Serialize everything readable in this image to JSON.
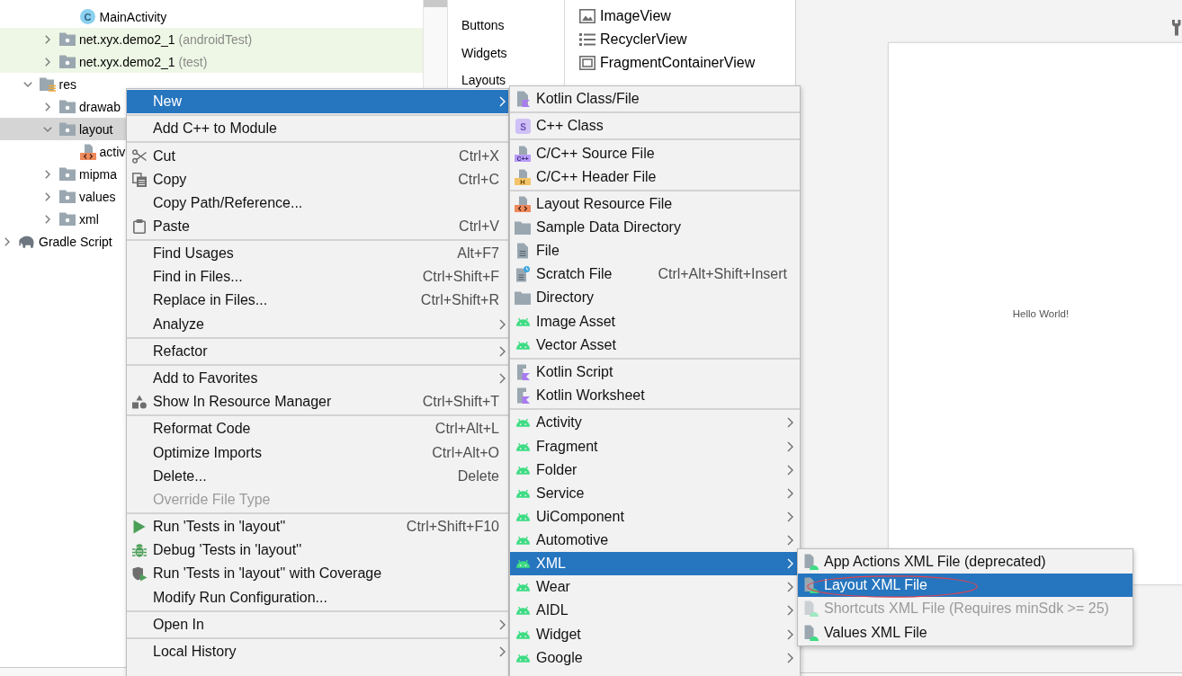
{
  "project_tree": {
    "items": [
      {
        "children": [
          {
            "children": [
              {
                "children": [
                  {
                    "label": "MainActivity",
                    "kind": "class",
                    "icon_text": "C",
                    "selected": false,
                    "test_source": false
                  }
                ]
              },
              {
                "label": "net.xyx.demo2_1",
                "note": "(androidTest)",
                "kind": "folder",
                "expanded": false,
                "selected": false,
                "test_source": true
              },
              {
                "label": "net.xyx.demo2_1",
                "note": "(test)",
                "kind": "folder",
                "expanded": false,
                "selected": false,
                "test_source": true
              }
            ]
          },
          {
            "label": "res",
            "kind": "resfolder",
            "expanded": true,
            "selected": false,
            "test_source": false,
            "children": [
              {
                "label": "drawab",
                "kind": "folder",
                "expanded": false,
                "selected": false,
                "test_source": false
              },
              {
                "label": "layout",
                "kind": "folder",
                "expanded": true,
                "selected": true,
                "test_source": false,
                "children": [
                  {
                    "label": "activ",
                    "kind": "layout",
                    "selected": false,
                    "test_source": false
                  }
                ]
              },
              {
                "label": "mipma",
                "kind": "folder",
                "expanded": false,
                "selected": false,
                "test_source": false
              },
              {
                "label": "values",
                "kind": "folder",
                "expanded": false,
                "selected": false,
                "test_source": false
              },
              {
                "label": "xml",
                "kind": "folder",
                "expanded": false,
                "selected": false,
                "test_source": false
              }
            ]
          }
        ]
      },
      {
        "label": "Gradle Script",
        "kind": "gradle",
        "expanded": false,
        "selected": false,
        "test_source": false
      }
    ]
  },
  "palette": {
    "categories": [
      {
        "label": "Buttons",
        "selected": false
      },
      {
        "label": "Widgets",
        "selected": false
      },
      {
        "label": "Layouts",
        "selected": false
      }
    ],
    "widgets": [
      {
        "label": "ImageView",
        "kind": "image"
      },
      {
        "label": "RecyclerView",
        "kind": "list"
      },
      {
        "label": "FragmentContainerView",
        "kind": "frame"
      }
    ]
  },
  "design": {
    "canvas_text": "Hello World!"
  },
  "context_menu": {
    "groups": [
      {
        "items": [
          {
            "label": "New",
            "kind": "plain",
            "selected": true,
            "disabled": false,
            "has_submenu": true,
            "submenu": {
              "groups": [
                {
                  "items": [
                    {
                      "label": "Kotlin Class/File",
                      "kind": "kotlin",
                      "selected": false,
                      "disabled": false,
                      "has_submenu": false
                    }
                  ]
                },
                {
                  "items": [
                    {
                      "label": "C++ Class",
                      "kind": "cppclass",
                      "icon_text": "S",
                      "selected": false,
                      "disabled": false,
                      "has_submenu": false
                    }
                  ]
                },
                {
                  "items": [
                    {
                      "label": "C/C++ Source File",
                      "kind": "cppsource",
                      "icon_text": "C++",
                      "selected": false,
                      "disabled": false,
                      "has_submenu": false
                    },
                    {
                      "label": "C/C++ Header File",
                      "kind": "cppheader",
                      "icon_text": "H",
                      "selected": false,
                      "disabled": false,
                      "has_submenu": false
                    }
                  ]
                },
                {
                  "items": [
                    {
                      "label": "Layout Resource File",
                      "kind": "layout",
                      "selected": false,
                      "disabled": false,
                      "has_submenu": false
                    },
                    {
                      "label": "Sample Data Directory",
                      "kind": "folder",
                      "selected": false,
                      "disabled": false,
                      "has_submenu": false
                    },
                    {
                      "label": "File",
                      "kind": "file",
                      "selected": false,
                      "disabled": false,
                      "has_submenu": false
                    },
                    {
                      "label": "Scratch File",
                      "shortcut": "Ctrl+Alt+Shift+Insert",
                      "kind": "scratch",
                      "selected": false,
                      "disabled": false,
                      "has_submenu": false
                    },
                    {
                      "label": "Directory",
                      "kind": "folder",
                      "selected": false,
                      "disabled": false,
                      "has_submenu": false
                    },
                    {
                      "label": "Image Asset",
                      "kind": "android",
                      "selected": false,
                      "disabled": false,
                      "has_submenu": false
                    },
                    {
                      "label": "Vector Asset",
                      "kind": "android",
                      "selected": false,
                      "disabled": false,
                      "has_submenu": false
                    }
                  ]
                },
                {
                  "items": [
                    {
                      "label": "Kotlin Script",
                      "kind": "kotlinscript",
                      "selected": false,
                      "disabled": false,
                      "has_submenu": false
                    },
                    {
                      "label": "Kotlin Worksheet",
                      "kind": "kotlinscript",
                      "selected": false,
                      "disabled": false,
                      "has_submenu": false
                    }
                  ]
                },
                {
                  "items": [
                    {
                      "label": "Activity",
                      "kind": "android",
                      "selected": false,
                      "disabled": false,
                      "has_submenu": true
                    },
                    {
                      "label": "Fragment",
                      "kind": "android",
                      "selected": false,
                      "disabled": false,
                      "has_submenu": true
                    },
                    {
                      "label": "Folder",
                      "kind": "android",
                      "selected": false,
                      "disabled": false,
                      "has_submenu": true
                    },
                    {
                      "label": "Service",
                      "kind": "android",
                      "selected": false,
                      "disabled": false,
                      "has_submenu": true
                    },
                    {
                      "label": "UiComponent",
                      "kind": "android",
                      "selected": false,
                      "disabled": false,
                      "has_submenu": true
                    },
                    {
                      "label": "Automotive",
                      "kind": "android",
                      "selected": false,
                      "disabled": false,
                      "has_submenu": true
                    },
                    {
                      "label": "XML",
                      "kind": "android",
                      "selected": true,
                      "disabled": false,
                      "has_submenu": true,
                      "submenu": {
                        "groups": [
                          {
                            "items": [
                              {
                                "label": "App Actions XML File (deprecated)",
                                "kind": "xmlfile",
                                "selected": false,
                                "disabled": false,
                                "has_submenu": false,
                                "circled": false
                              },
                              {
                                "label": "Layout XML File",
                                "kind": "xmlfile",
                                "selected": true,
                                "disabled": false,
                                "has_submenu": false,
                                "circled": true
                              },
                              {
                                "label": "Shortcuts XML File (Requires minSdk >= 25)",
                                "kind": "xmlfile",
                                "selected": false,
                                "disabled": true,
                                "has_submenu": false,
                                "circled": false
                              },
                              {
                                "label": "Values XML File",
                                "kind": "xmlfile",
                                "selected": false,
                                "disabled": false,
                                "has_submenu": false,
                                "circled": false
                              }
                            ]
                          }
                        ]
                      }
                    },
                    {
                      "label": "Wear",
                      "kind": "android",
                      "selected": false,
                      "disabled": false,
                      "has_submenu": true
                    },
                    {
                      "label": "AIDL",
                      "kind": "android",
                      "selected": false,
                      "disabled": false,
                      "has_submenu": true
                    },
                    {
                      "label": "Widget",
                      "kind": "android",
                      "selected": false,
                      "disabled": false,
                      "has_submenu": true
                    },
                    {
                      "label": "Google",
                      "kind": "android",
                      "selected": false,
                      "disabled": false,
                      "has_submenu": true
                    }
                  ]
                }
              ]
            }
          }
        ]
      },
      {
        "items": [
          {
            "label": "Add C++ to Module",
            "kind": "plain",
            "selected": false,
            "disabled": false,
            "has_submenu": false
          }
        ]
      },
      {
        "items": [
          {
            "label": "Cut",
            "shortcut": "Ctrl+X",
            "kind": "cut",
            "selected": false,
            "disabled": false,
            "has_submenu": false
          },
          {
            "label": "Copy",
            "shortcut": "Ctrl+C",
            "kind": "copy",
            "selected": false,
            "disabled": false,
            "has_submenu": false
          },
          {
            "label": "Copy Path/Reference...",
            "kind": "plain",
            "selected": false,
            "disabled": false,
            "has_submenu": false
          },
          {
            "label": "Paste",
            "shortcut": "Ctrl+V",
            "kind": "paste",
            "selected": false,
            "disabled": false,
            "has_submenu": false
          }
        ]
      },
      {
        "items": [
          {
            "label": "Find Usages",
            "shortcut": "Alt+F7",
            "kind": "plain",
            "selected": false,
            "disabled": false,
            "has_submenu": false
          },
          {
            "label": "Find in Files...",
            "shortcut": "Ctrl+Shift+F",
            "kind": "plain",
            "selected": false,
            "disabled": false,
            "has_submenu": false
          },
          {
            "label": "Replace in Files...",
            "shortcut": "Ctrl+Shift+R",
            "kind": "plain",
            "selected": false,
            "disabled": false,
            "has_submenu": false
          },
          {
            "label": "Analyze",
            "kind": "plain",
            "selected": false,
            "disabled": false,
            "has_submenu": true
          }
        ]
      },
      {
        "items": [
          {
            "label": "Refactor",
            "kind": "plain",
            "selected": false,
            "disabled": false,
            "has_submenu": true
          }
        ]
      },
      {
        "items": [
          {
            "label": "Add to Favorites",
            "kind": "plain",
            "selected": false,
            "disabled": false,
            "has_submenu": true
          },
          {
            "label": "Show In Resource Manager",
            "shortcut": "Ctrl+Shift+T",
            "kind": "resources",
            "selected": false,
            "disabled": false,
            "has_submenu": false
          }
        ]
      },
      {
        "items": [
          {
            "label": "Reformat Code",
            "shortcut": "Ctrl+Alt+L",
            "kind": "plain",
            "selected": false,
            "disabled": false,
            "has_submenu": false
          },
          {
            "label": "Optimize Imports",
            "shortcut": "Ctrl+Alt+O",
            "kind": "plain",
            "selected": false,
            "disabled": false,
            "has_submenu": false
          },
          {
            "label": "Delete...",
            "shortcut": "Delete",
            "kind": "plain",
            "selected": false,
            "disabled": false,
            "has_submenu": false
          },
          {
            "label": "Override File Type",
            "kind": "plain",
            "selected": false,
            "disabled": true,
            "has_submenu": false
          }
        ]
      },
      {
        "items": [
          {
            "label": "Run 'Tests in 'layout''",
            "shortcut": "Ctrl+Shift+F10",
            "kind": "run",
            "selected": false,
            "disabled": false,
            "has_submenu": false
          },
          {
            "label": "Debug 'Tests in 'layout''",
            "kind": "debug",
            "selected": false,
            "disabled": false,
            "has_submenu": false
          },
          {
            "label": "Run 'Tests in 'layout'' with Coverage",
            "kind": "coverage",
            "selected": false,
            "disabled": false,
            "has_submenu": false
          },
          {
            "label": "Modify Run Configuration...",
            "kind": "plain",
            "selected": false,
            "disabled": false,
            "has_submenu": false
          }
        ]
      },
      {
        "items": [
          {
            "label": "Open In",
            "kind": "plain",
            "selected": false,
            "disabled": false,
            "has_submenu": true
          }
        ]
      },
      {
        "items": [
          {
            "label": "Local History",
            "kind": "plain",
            "selected": false,
            "disabled": false,
            "has_submenu": true
          }
        ]
      }
    ]
  }
}
